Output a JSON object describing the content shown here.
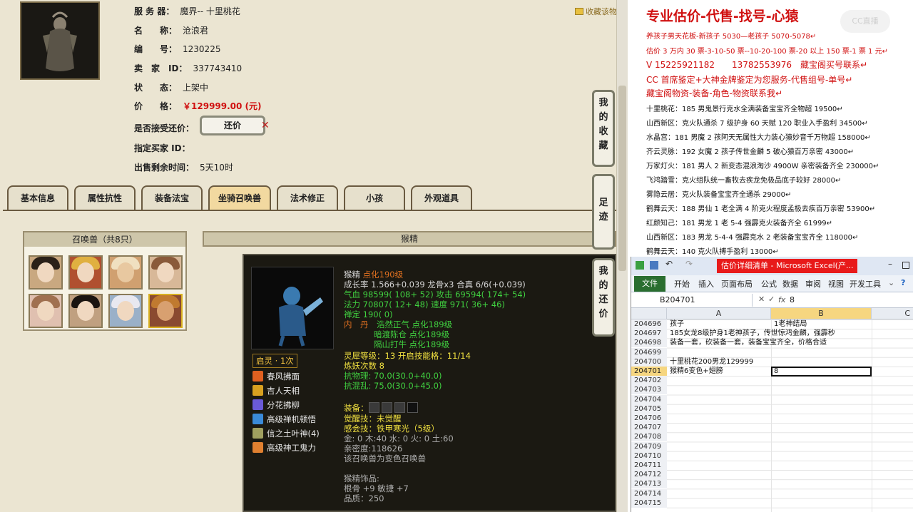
{
  "listing": {
    "server_label": "服 务 器：",
    "server_value": "魔界-- 十里桃花",
    "name_label": "名　　称：",
    "name_value": "沧浪君",
    "id_label": "编　　号：",
    "id_value": "1230225",
    "seller_label": "卖　家　ID：",
    "seller_value": "337743410",
    "status_label": "状　　态：",
    "status_value": "上架中",
    "price_label": "价　　格：",
    "price_value": "￥129999.00 (元)",
    "bargain_label": "是否接受还价：",
    "bargain_button": "还价",
    "buyer_label": "指定买家 ID：",
    "time_label": "出售剩余时间：",
    "time_value": "5天10时",
    "favorite_link": "收藏该物品"
  },
  "tabs": [
    "基本信息",
    "属性抗性",
    "装备法宝",
    "坐骑召唤兽",
    "法术修正",
    "小孩",
    "外观道具"
  ],
  "active_tab": "坐骑召唤兽",
  "side_buttons": [
    {
      "chars": [
        "我",
        "的",
        "收",
        "藏"
      ]
    },
    {
      "chars": [
        "足",
        "迹"
      ]
    },
    {
      "chars": [
        "我",
        "的",
        "还",
        "价"
      ]
    }
  ],
  "summon_panel": {
    "title": "召唤兽（共8只）"
  },
  "detail": {
    "header": "猴精",
    "name": "猴精",
    "level": "点化190级",
    "growth": "成长率 1.566+0.039 龙骨x3 合真 6/6(+0.039)",
    "hp_label": "气血",
    "hp": "98599( 108+ 52)",
    "atk_label": "攻击",
    "atk": "69594( 174+ 54)",
    "mp_label": "法力",
    "mp": "70807( 12+ 48)",
    "spd_label": "速度",
    "spd": "971( 36+ 46)",
    "defense": "禅定 190( 0)",
    "inner_label": "内　丹",
    "inner1": "浩然正气 点化189级",
    "inner2": "暗渡陈仓 点化189级",
    "inner3": "隔山打牛 点化189级",
    "spirit": "灵犀等级：13 开启技能格：11/14",
    "refine": "炼妖次数 8",
    "resist_phys": "抗物理: 70.0(30.0+40.0)",
    "resist_chaos": "抗混乱: 75.0(30.0+45.0)",
    "equip_label": "装备：",
    "awaken": "觉醒技：未觉醒",
    "perceive_label": "感会技：",
    "perceive": "铁甲寒光（5级）",
    "elements": "金: 0 木:40 水: 0 火: 0 土:60",
    "intimacy": "亲密度:118626",
    "variant": "该召唤兽为变色召唤兽",
    "accessory_title": "猴精饰品:",
    "accessory_stats": "根骨 +9 敏捷 +7",
    "accessory_quality": "品质：250",
    "awaken_badge": "启灵 · 1次",
    "skills": [
      "春风拂面",
      "吉人天相",
      "分花拂柳",
      "高级禅机顿悟",
      "信之土叶神(4)",
      "高级神工鬼力"
    ],
    "skill_colors": [
      "#e06020",
      "#d8a020",
      "#6a5ad8",
      "#3a8ad8",
      "#a0a060",
      "#e08030"
    ]
  },
  "ad": {
    "headline": "专业估价-代售-找号-心猿",
    "lines": [
      {
        "t": "养孩子男天花板-新孩子 5030—老孩子 5070-5078↵",
        "c": "red"
      },
      {
        "t": "估价 3 万内 30 票-3-10-50 票--10-20-100 票-20 以上 150 票-1 票 1 元↵",
        "c": "red"
      },
      {
        "t": "V 15225921182　　13782553976　藏宝阁买号联系↵",
        "c": "red"
      },
      {
        "t": "CC 首席鉴定+大神金牌鉴定为您服务-代售组号-单号↵",
        "c": "red"
      },
      {
        "t": "藏宝阁物资-装备-角色-物资联系我↵",
        "c": "red"
      },
      {
        "t": "十里桃花：185 男鬼景行克水全满装备宝宝齐全物超 19500↵",
        "c": "blk"
      },
      {
        "t": "山西新区：克火队通杀 7 级护身 60 天赋 120 职业入手盈利 34500↵",
        "c": "blk"
      },
      {
        "t": "水晶宫：181 男魔 2 孩阿天无属性大力装心猿妙音千万物超 158000↵",
        "c": "blk"
      },
      {
        "t": "齐云灵脉：192 女魔 2 孩子传世金麟 5 破心猿百万亲密 43000↵",
        "c": "blk"
      },
      {
        "t": "万家灯火：181 男人 2 新变态混浪淘沙 4900W 亲密装备齐全 230000↵",
        "c": "blk"
      },
      {
        "t": "飞鸿踏雪：克火组队统一畜牧去疾龙免极品底子较好 28000↵",
        "c": "blk"
      },
      {
        "t": "雾隐云居：克火队装备宝宝齐全通杀 29000↵",
        "c": "blk"
      },
      {
        "t": "鹤舞云天：188 男仙 1 老全满 4 阶克火程度孟极去疾百万亲密 53900↵",
        "c": "blk"
      },
      {
        "t": "红颜知己：181 男龙 1 老 5-4 强霹克火装备齐全 61999↵",
        "c": "blk"
      },
      {
        "t": "山西新区：183 男龙 5-4-4 强霹克水 2 老装备宝宝齐全 118000↵",
        "c": "blk"
      },
      {
        "t": "鹤舞云天：140 克火队搏手盈利 13000↵",
        "c": "blk"
      }
    ],
    "logo": "CC直播"
  },
  "excel": {
    "title": "估价详细清单 - Microsoft Excel(产...",
    "menu": [
      "开始",
      "插入",
      "页面布局",
      "公式",
      "数据",
      "审阅",
      "视图",
      "开发工具"
    ],
    "file": "文件",
    "namebox": "B204701",
    "fx": "fx",
    "formula_value": "8",
    "col_a": "A",
    "col_b": "B",
    "col_c": "C",
    "rows": [
      {
        "n": "204696",
        "a": "孩子",
        "b": "1老神结局"
      },
      {
        "n": "204697",
        "a": "185女龙8级护身1老神孩子，传世惊鸿金麟，强霹秒",
        "b": ""
      },
      {
        "n": "204698",
        "a": "装备一套，砍装备一套，装备宝宝齐全，价格合适",
        "b": ""
      },
      {
        "n": "204699",
        "a": "",
        "b": ""
      },
      {
        "n": "204700",
        "a": "十里桃花200男龙129999",
        "b": ""
      },
      {
        "n": "204701",
        "a": "猴精6变色+翅膀",
        "b": "8"
      },
      {
        "n": "204702",
        "a": "",
        "b": ""
      },
      {
        "n": "204703",
        "a": "",
        "b": ""
      },
      {
        "n": "204704",
        "a": "",
        "b": ""
      },
      {
        "n": "204705",
        "a": "",
        "b": ""
      },
      {
        "n": "204706",
        "a": "",
        "b": ""
      },
      {
        "n": "204707",
        "a": "",
        "b": ""
      },
      {
        "n": "204708",
        "a": "",
        "b": ""
      },
      {
        "n": "204709",
        "a": "",
        "b": ""
      },
      {
        "n": "204710",
        "a": "",
        "b": ""
      },
      {
        "n": "204711",
        "a": "",
        "b": ""
      },
      {
        "n": "204712",
        "a": "",
        "b": ""
      },
      {
        "n": "204713",
        "a": "",
        "b": ""
      },
      {
        "n": "204714",
        "a": "",
        "b": ""
      },
      {
        "n": "204715",
        "a": "",
        "b": ""
      }
    ]
  },
  "colors": {
    "price": "#d01010",
    "accent_yellow": "#f0e040",
    "accent_green": "#40d040",
    "excel_file": "#2a6e30",
    "excel_title_red": "#e81a1a"
  }
}
